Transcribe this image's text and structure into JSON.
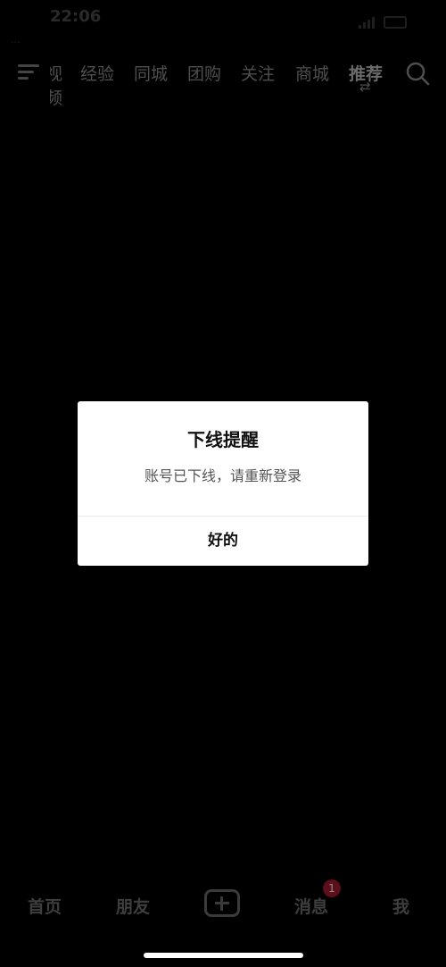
{
  "status_bar": {
    "time": "22:06",
    "carrier_text": "...",
    "colors": {
      "dim": "#1e1e1e"
    }
  },
  "top_nav": {
    "cut_tab": "视频",
    "tabs": [
      "经验",
      "同城",
      "团购",
      "关注",
      "商城"
    ],
    "active_tab": "推荐",
    "icons": [
      "menu-icon",
      "switch-icon",
      "search-icon"
    ]
  },
  "dialog": {
    "title": "下线提醒",
    "message": "账号已下线，请重新登录",
    "ok_label": "好的"
  },
  "bottom_nav": {
    "home": "首页",
    "friends": "朋友",
    "messages": "消息",
    "messages_badge": "1",
    "me": "我"
  },
  "colors": {
    "background": "#000000",
    "dialog": "#ffffff",
    "badge": "#5a0f1a"
  }
}
